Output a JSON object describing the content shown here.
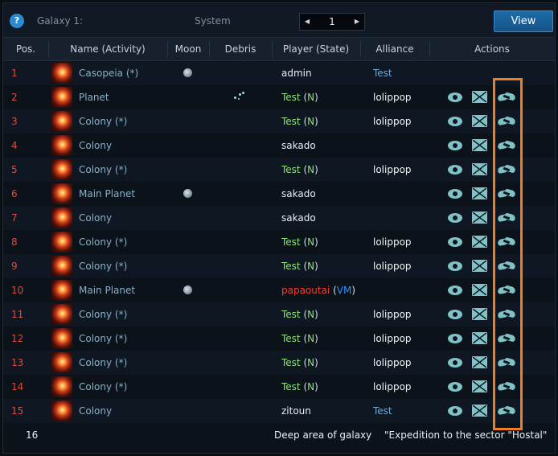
{
  "toolbar": {
    "help_label": "?",
    "galaxy_label": "Galaxy 1:",
    "system_label": "System",
    "system_value": "1",
    "prev_label": "◀",
    "next_label": "▶",
    "view_label": "View"
  },
  "columns": {
    "pos": "Pos.",
    "name": "Name (Activity)",
    "moon": "Moon",
    "debris": "Debris",
    "player": "Player (State)",
    "alliance": "Alliance",
    "actions": "Actions"
  },
  "rows": [
    {
      "pos": "1",
      "name": "Casopeia (*)",
      "moon": true,
      "debris": false,
      "player": "admin",
      "player_style": "plain",
      "state": "",
      "alliance": "Test",
      "alliance_link": true,
      "actions": false
    },
    {
      "pos": "2",
      "name": "Planet",
      "moon": false,
      "debris": true,
      "player": "Test",
      "player_style": "green",
      "state": "N",
      "alliance": "lolippop",
      "alliance_link": false,
      "actions": true
    },
    {
      "pos": "3",
      "name": "Colony (*)",
      "moon": false,
      "debris": false,
      "player": "Test",
      "player_style": "green",
      "state": "N",
      "alliance": "lolippop",
      "alliance_link": false,
      "actions": true
    },
    {
      "pos": "4",
      "name": "Colony",
      "moon": false,
      "debris": false,
      "player": "sakado",
      "player_style": "plain",
      "state": "",
      "alliance": "",
      "alliance_link": false,
      "actions": true
    },
    {
      "pos": "5",
      "name": "Colony (*)",
      "moon": false,
      "debris": false,
      "player": "Test",
      "player_style": "green",
      "state": "N",
      "alliance": "lolippop",
      "alliance_link": false,
      "actions": true
    },
    {
      "pos": "6",
      "name": "Main Planet",
      "moon": true,
      "debris": false,
      "player": "sakado",
      "player_style": "plain",
      "state": "",
      "alliance": "",
      "alliance_link": false,
      "actions": true
    },
    {
      "pos": "7",
      "name": "Colony",
      "moon": false,
      "debris": false,
      "player": "sakado",
      "player_style": "plain",
      "state": "",
      "alliance": "",
      "alliance_link": false,
      "actions": true
    },
    {
      "pos": "8",
      "name": "Colony (*)",
      "moon": false,
      "debris": false,
      "player": "Test",
      "player_style": "green",
      "state": "N",
      "alliance": "lolippop",
      "alliance_link": false,
      "actions": true
    },
    {
      "pos": "9",
      "name": "Colony (*)",
      "moon": false,
      "debris": false,
      "player": "Test",
      "player_style": "green",
      "state": "N",
      "alliance": "lolippop",
      "alliance_link": false,
      "actions": true
    },
    {
      "pos": "10",
      "name": "Main Planet",
      "moon": true,
      "debris": false,
      "player": "papaoutai",
      "player_style": "red",
      "state": "VM",
      "alliance": "",
      "alliance_link": false,
      "actions": true
    },
    {
      "pos": "11",
      "name": "Colony (*)",
      "moon": false,
      "debris": false,
      "player": "Test",
      "player_style": "green",
      "state": "N",
      "alliance": "lolippop",
      "alliance_link": false,
      "actions": true
    },
    {
      "pos": "12",
      "name": "Colony (*)",
      "moon": false,
      "debris": false,
      "player": "Test",
      "player_style": "green",
      "state": "N",
      "alliance": "lolippop",
      "alliance_link": false,
      "actions": true
    },
    {
      "pos": "13",
      "name": "Colony (*)",
      "moon": false,
      "debris": false,
      "player": "Test",
      "player_style": "green",
      "state": "N",
      "alliance": "lolippop",
      "alliance_link": false,
      "actions": true
    },
    {
      "pos": "14",
      "name": "Colony (*)",
      "moon": false,
      "debris": false,
      "player": "Test",
      "player_style": "green",
      "state": "N",
      "alliance": "lolippop",
      "alliance_link": false,
      "actions": true
    },
    {
      "pos": "15",
      "name": "Colony",
      "moon": false,
      "debris": false,
      "player": "zitoun",
      "player_style": "plain",
      "state": "",
      "alliance": "Test",
      "alliance_link": true,
      "actions": true
    }
  ],
  "footer_row": {
    "pos": "16",
    "deep_space": "Deep area of galaxy",
    "expedition": "\"Expedition to the sector \"Hostal\""
  },
  "colors": {
    "highlight": "#ee7d28",
    "position": "#e14b3d",
    "accent": "#1c6ba8"
  },
  "icons": {
    "view": "eye-icon",
    "message": "mail-icon",
    "alliance_request": "handshake-icon",
    "moon": "moon-icon",
    "debris": "debris-icon",
    "help": "help-icon"
  }
}
